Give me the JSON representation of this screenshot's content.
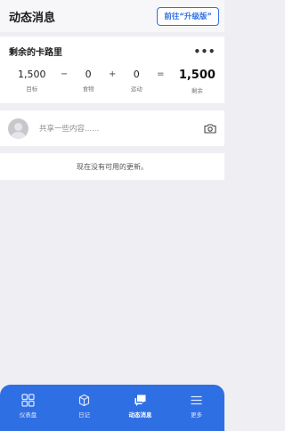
{
  "header": {
    "title": "动态消息",
    "upgrade_label": "前往“升级版”"
  },
  "calories": {
    "title": "剩余的卡路里",
    "goal_value": "1,500",
    "goal_label": "目标",
    "op_minus": "−",
    "food_value": "0",
    "food_label": "食物",
    "op_plus": "+",
    "exercise_value": "0",
    "exercise_label": "运动",
    "op_equals": "=",
    "remaining_value": "1,500",
    "remaining_label": "剩余"
  },
  "composer": {
    "placeholder": "共享一些内容......"
  },
  "feed": {
    "empty_message": "现在没有可用的更新。"
  },
  "tabbar": {
    "items": [
      {
        "label": "仪表盘",
        "icon": "dashboard-icon"
      },
      {
        "label": "日记",
        "icon": "diary-icon"
      },
      {
        "label": "动态消息",
        "icon": "newsfeed-icon"
      },
      {
        "label": "更多",
        "icon": "menu-icon"
      }
    ],
    "active": "动态消息"
  },
  "colors": {
    "accent": "#2f6fe4",
    "background": "#eeeef3"
  }
}
